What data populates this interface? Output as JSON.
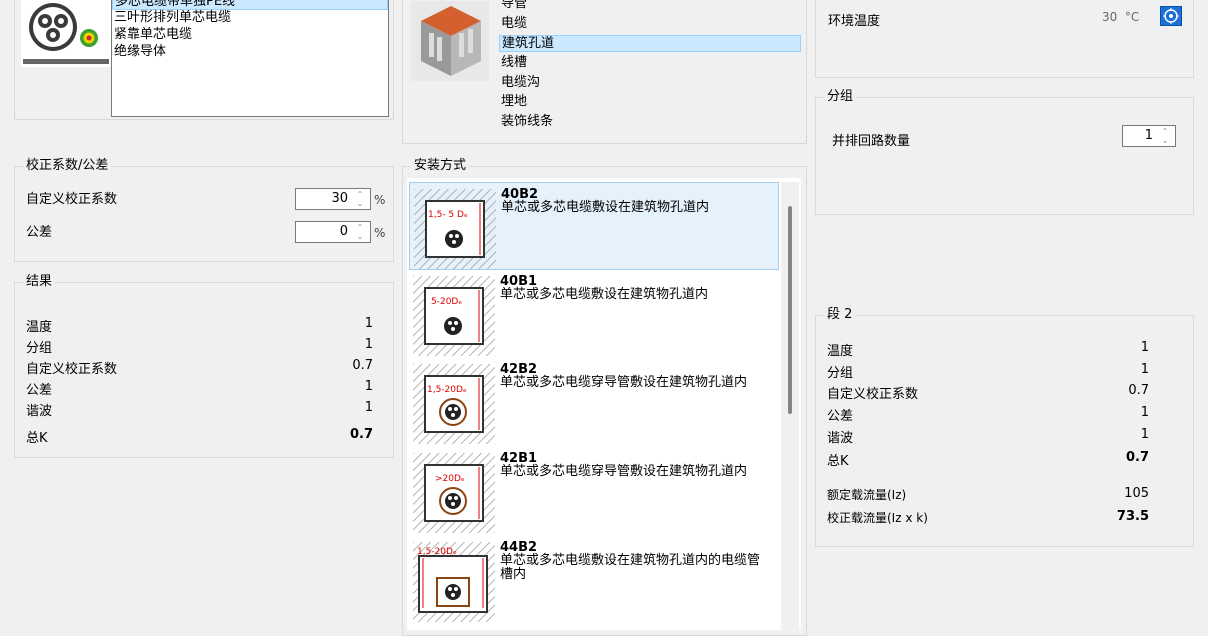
{
  "cable_list": {
    "items": [
      "多芯电缆带单独PE线",
      "三叶形排列单芯电缆",
      "紧靠单芯电缆",
      "绝缘导体"
    ],
    "selected_index": 0
  },
  "conduit_list": {
    "items": [
      "导管",
      "电缆",
      "建筑孔道",
      "线槽",
      "电缆沟",
      "埋地",
      "装饰线条"
    ],
    "selected_index": 2
  },
  "env": {
    "label": "环境温度",
    "value": "30",
    "unit": "°C"
  },
  "grouping": {
    "title": "分组",
    "label": "并排回路数量",
    "value": "1"
  },
  "correction": {
    "title": "校正系数/公差",
    "custom_label": "自定义校正系数",
    "custom_value": "30",
    "custom_unit": "%",
    "tolerance_label": "公差",
    "tolerance_value": "0",
    "tolerance_unit": "%"
  },
  "results": {
    "title": "结果",
    "rows": [
      {
        "label": "温度",
        "value": "1"
      },
      {
        "label": "分组",
        "value": "1"
      },
      {
        "label": "自定义校正系数",
        "value": "0.7"
      },
      {
        "label": "公差",
        "value": "1"
      },
      {
        "label": "谐波",
        "value": "1"
      }
    ],
    "total_label": "总K",
    "total_value": "0.7"
  },
  "install": {
    "title": "安装方式",
    "methods": [
      {
        "code": "40B2",
        "desc": "单芯或多芯电缆敷设在建筑物孔道内",
        "dim": "1,5- 5 Dₑ"
      },
      {
        "code": "40B1",
        "desc": "单芯或多芯电缆敷设在建筑物孔道内",
        "dim": "5-20Dₑ"
      },
      {
        "code": "42B2",
        "desc": "单芯或多芯电缆穿导管敷设在建筑物孔道内",
        "dim": "1,5-20Dₑ"
      },
      {
        "code": "42B1",
        "desc": "单芯或多芯电缆穿导管敷设在建筑物孔道内",
        "dim": ">20Dₑ"
      },
      {
        "code": "44B2",
        "desc": "单芯或多芯电缆敷设在建筑物孔道内的电缆管槽内",
        "dim": "1,5-20Dₑ"
      }
    ],
    "selected_index": 0
  },
  "segment2": {
    "title": "段 2",
    "rows": [
      {
        "label": "温度",
        "value": "1"
      },
      {
        "label": "分组",
        "value": "1"
      },
      {
        "label": "自定义校正系数",
        "value": "0.7"
      },
      {
        "label": "公差",
        "value": "1"
      },
      {
        "label": "谐波",
        "value": "1"
      }
    ],
    "total_label": "总K",
    "total_value": "0.7",
    "rated_label": "额定载流量(Iz)",
    "rated_value": "105",
    "corrected_label": "校正载流量(Iz x k)",
    "corrected_value": "73.5"
  }
}
